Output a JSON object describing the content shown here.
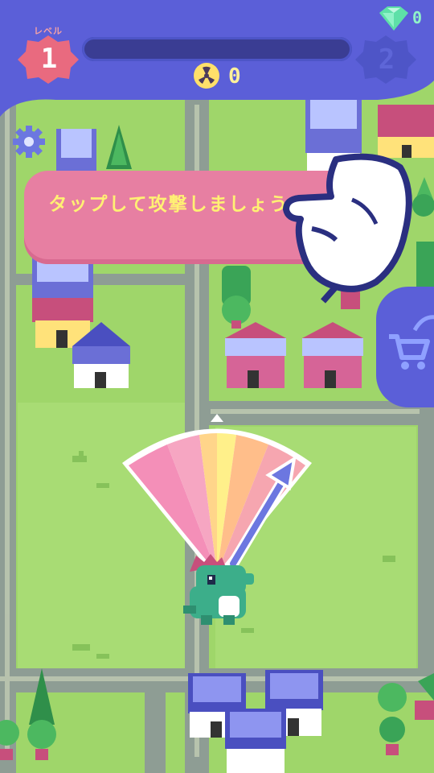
{
  "header": {
    "level_label": "レベル",
    "current_level": "1",
    "next_level": "2",
    "progress": 0,
    "radiation_count": "0",
    "gem_count": "0"
  },
  "tutorial": {
    "message": "タップして攻撃しましょう"
  },
  "icons": {
    "settings": "gear-icon",
    "shop": "cart-icon",
    "gem": "diamond-icon",
    "radiation": "radiation-icon",
    "pointer": "pointing-hand-icon"
  },
  "colors": {
    "header": "#5b5fd8",
    "banner": "#e77fa2",
    "banner_text": "#fff173",
    "grass": "#9fd66a",
    "road": "#8a9a8a",
    "level_badge": "#e96a7f",
    "dino": "#3cae8a"
  }
}
